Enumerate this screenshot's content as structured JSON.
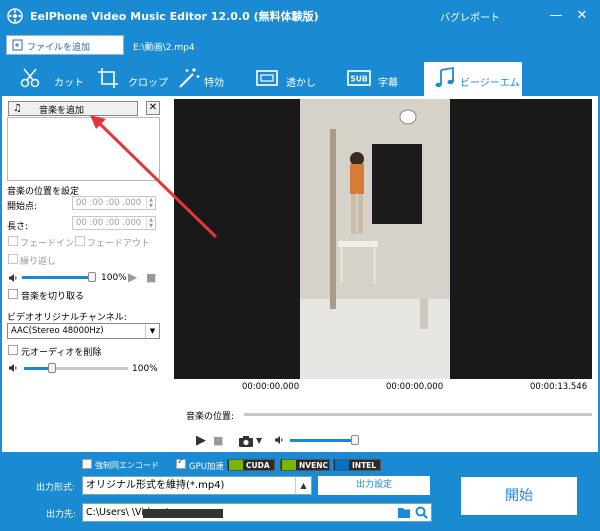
{
  "window": {
    "title": "EelPhone Video Music Editor 12.0.0 (無料体験版)",
    "buy_label": "バグレポート",
    "minimize": "—",
    "close": "✕"
  },
  "file": {
    "add_file_label": "ファイルを追加",
    "path": "E:\\動画\\2.mp4"
  },
  "tabs": [
    {
      "label": "カット",
      "icon": "scissors-icon"
    },
    {
      "label": "クロップ",
      "icon": "crop-icon"
    },
    {
      "label": "特効",
      "icon": "magic-wand-icon"
    },
    {
      "label": "透かし",
      "icon": "watermark-icon"
    },
    {
      "label": "字幕",
      "icon": "subtitle-icon"
    },
    {
      "label": "ビージーエム",
      "icon": "music-note-icon",
      "active": true
    }
  ],
  "music": {
    "add_music_label": "音楽を追加",
    "close_label": "✕",
    "position_heading": "音楽の位置を設定",
    "start_label": "開始点:",
    "start_value": "00 :00 :00 .000",
    "length_label": "長さ:",
    "length_value": "00 :00 :00 .000",
    "fade_in_label": "フェードイン",
    "fade_out_label": "フェードアウト",
    "loop_label": "繰り返し",
    "volume_value": "100%",
    "volume_level": 1.0,
    "cut_music_label": "音楽を切り取る",
    "channel_label": "ビデオオリジナルチャンネル:",
    "channel_value": "AAC(Stereo 48000Hz)",
    "remove_audio_label": "元オーディオを削除",
    "orig_volume_value": "100%",
    "orig_volume_level": 0.25
  },
  "player": {
    "time_start": "00:00:00.000",
    "time_current": "00:00:00.000",
    "time_end": "00:00:13.546",
    "position_label": "音楽の位置:",
    "player_volume_level": 0.85
  },
  "bottom": {
    "hw_label": "強制同エンコード",
    "gpu_label": "GPU加速",
    "cuda": "CUDA",
    "nvenc": "NVENC",
    "intel": "INTEL",
    "format_label": "出力形式:",
    "format_value": "オリジナル形式を維持(*.mp4)",
    "settings_label": "出力設定",
    "output_label": "出力先:",
    "output_value": "C:\\Users\\          \\Videos\\",
    "start_label": "開始"
  },
  "colors": {
    "accent": "#1a8ad2",
    "arrow": "#e8333a"
  }
}
